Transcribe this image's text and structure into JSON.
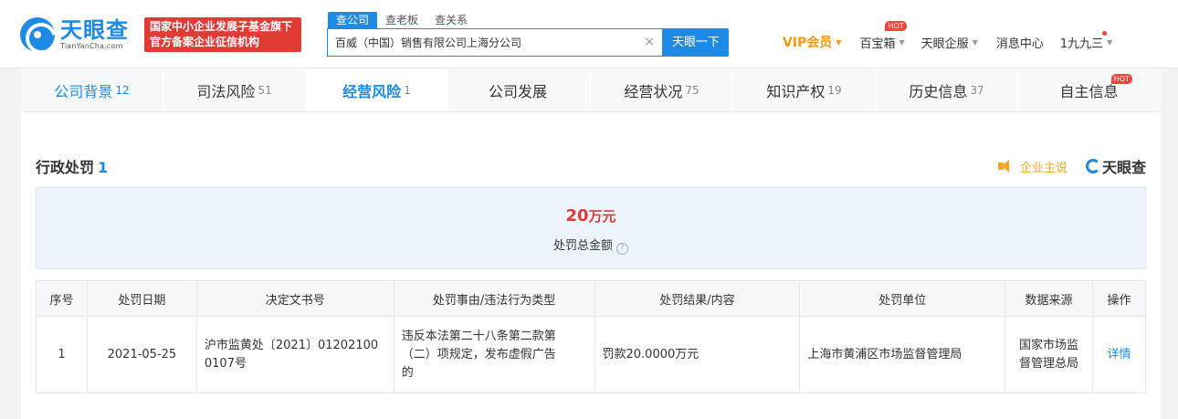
{
  "brand": {
    "name_cn": "天眼查",
    "name_en": "TianYanCha.com",
    "badge_line1": "国家中小企业发展子基金旗下",
    "badge_line2": "官方备案企业征信机构"
  },
  "search": {
    "tabs": [
      "查公司",
      "查老板",
      "查关系"
    ],
    "value": "百威（中国）销售有限公司上海分公司",
    "clear": "×",
    "button": "天眼一下"
  },
  "nav": {
    "vip": "VIP会员",
    "treasure": "百宝箱",
    "treasure_hot": "HOT",
    "enterprise": "天眼企服",
    "messages": "消息中心",
    "user": "1九九三"
  },
  "tabs": [
    {
      "label": "公司背景",
      "count": "12"
    },
    {
      "label": "司法风险",
      "count": "51"
    },
    {
      "label": "经营风险",
      "count": "1"
    },
    {
      "label": "公司发展",
      "count": ""
    },
    {
      "label": "经营状况",
      "count": "75"
    },
    {
      "label": "知识产权",
      "count": "19"
    },
    {
      "label": "历史信息",
      "count": "37"
    },
    {
      "label": "自主信息",
      "count": "",
      "hot": "HOT"
    }
  ],
  "section": {
    "title": "行政处罚",
    "count": "1",
    "self_say": "企业主说",
    "brand": "天眼查"
  },
  "summary": {
    "amount": "20",
    "unit": "万元",
    "label": "处罚总金额",
    "help": "?"
  },
  "table": {
    "headers": [
      "序号",
      "处罚日期",
      "决定文书号",
      "处罚事由/违法行为类型",
      "处罚结果/内容",
      "处罚单位",
      "数据来源",
      "操作"
    ],
    "rows": [
      {
        "index": "1",
        "date": "2021-05-25",
        "doc_line1": "沪市监黄处〔2021〕01202100",
        "doc_line2": "0107号",
        "reason_line1": "违反本法第二十八条第二款第",
        "reason_line2": "（二）项规定，发布虚假广告",
        "reason_line3": "的",
        "result": "罚款20.0000万元",
        "unit": "上海市黄浦区市场监督管理局",
        "source_line1": "国家市场监",
        "source_line2": "督管理总局",
        "action": "详情"
      }
    ]
  }
}
